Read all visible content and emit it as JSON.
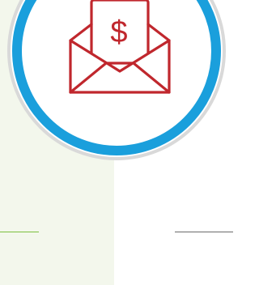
{
  "badge": {
    "icon": "envelope-dollar-icon",
    "symbol": "$",
    "colors": {
      "ring": "#1a9fdc",
      "outer_ring": "#d9d9d9",
      "inner_fill": "#ffffff",
      "icon": "#c0272d"
    }
  },
  "background": {
    "left_panel_color": "#f3f7ec"
  },
  "dividers": {
    "left_color": "#7cbf3e",
    "right_color": "#6b6b6b"
  }
}
